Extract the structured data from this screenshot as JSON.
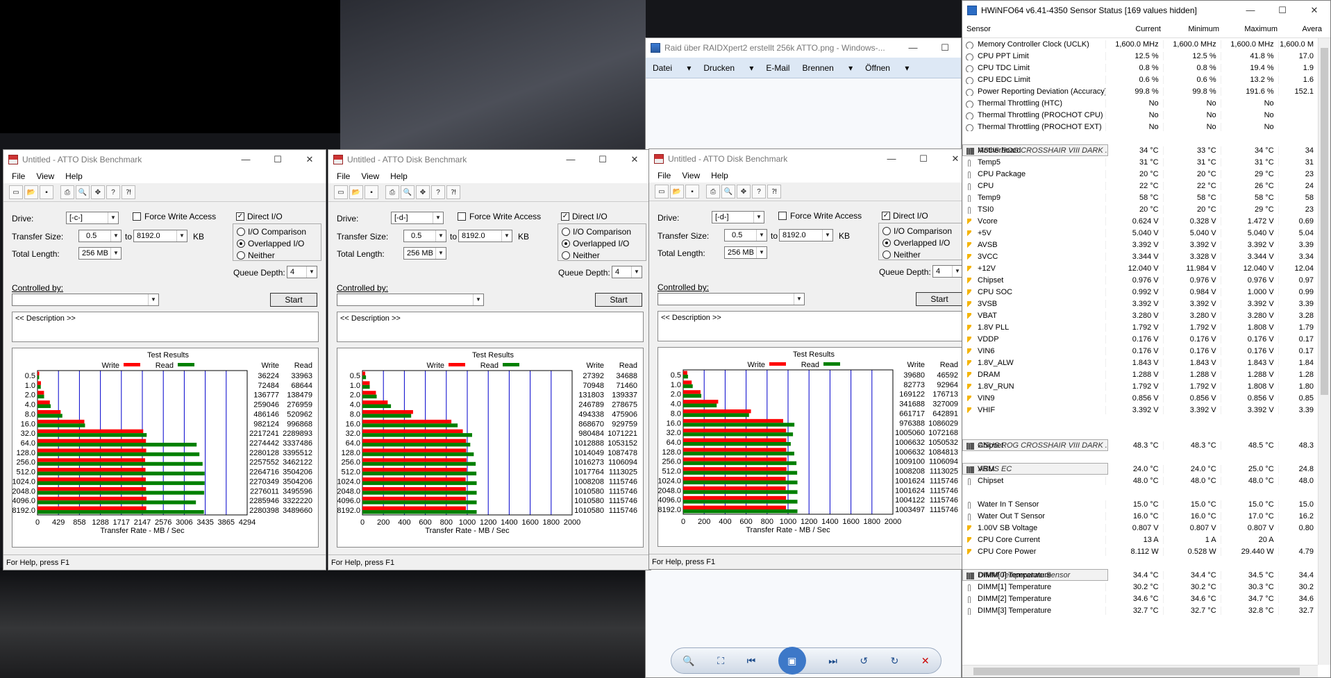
{
  "atto_windows": [
    {
      "title": "Untitled - ATTO Disk Benchmark",
      "menus": [
        "File",
        "View",
        "Help"
      ],
      "drive": "[-c-]",
      "force_write_access": "Force Write Access",
      "direct_io": "Direct I/O",
      "transfer_size_label": "Transfer Size:",
      "transfer_from": "0.5",
      "to_label": "to",
      "transfer_to": "8192.0",
      "kb_label": "KB",
      "total_length_label": "Total Length:",
      "total_length": "256 MB",
      "drive_label": "Drive:",
      "io_comparison": "I/O Comparison",
      "overlapped_io": "Overlapped I/O",
      "neither": "Neither",
      "queue_depth_label": "Queue Depth:",
      "queue_depth": "4",
      "controlled_by_label": "Controlled by:",
      "start_label": "Start",
      "description": "<< Description >>",
      "status": "For Help, press F1",
      "chart_data": {
        "type": "bar",
        "title": "Test Results",
        "xlabel": "Transfer Rate - MB / Sec",
        "legend": [
          "Write",
          "Read"
        ],
        "colors": {
          "write": "#ff0000",
          "read": "#008000"
        },
        "xlim": [
          0,
          4294
        ],
        "x_ticks": [
          "0",
          "429",
          "858",
          "1288",
          "1717",
          "2147",
          "2576",
          "3006",
          "3435",
          "3865",
          "4294"
        ],
        "categories": [
          "0.5",
          "1.0",
          "2.0",
          "4.0",
          "8.0",
          "16.0",
          "32.0",
          "64.0",
          "128.0",
          "256.0",
          "512.0",
          "1024.0",
          "2048.0",
          "4096.0",
          "8192.0"
        ],
        "write_header": "Write",
        "read_header": "Read",
        "write": [
          36224,
          72484,
          136777,
          259046,
          486146,
          982124,
          2217241,
          2274442,
          2280128,
          2257552,
          2264716,
          2270349,
          2276011,
          2285946,
          2280398
        ],
        "read": [
          33963,
          68644,
          138479,
          276959,
          520962,
          996868,
          2289893,
          3337486,
          3395512,
          3462122,
          3504206,
          3504206,
          3495596,
          3322220,
          3489660
        ]
      }
    },
    {
      "title": "Untitled - ATTO Disk Benchmark",
      "menus": [
        "File",
        "View",
        "Help"
      ],
      "drive": "[-d-]",
      "force_write_access": "Force Write Access",
      "direct_io": "Direct I/O",
      "transfer_size_label": "Transfer Size:",
      "transfer_from": "0.5",
      "to_label": "to",
      "transfer_to": "8192.0",
      "kb_label": "KB",
      "total_length_label": "Total Length:",
      "total_length": "256 MB",
      "drive_label": "Drive:",
      "io_comparison": "I/O Comparison",
      "overlapped_io": "Overlapped I/O",
      "neither": "Neither",
      "queue_depth_label": "Queue Depth:",
      "queue_depth": "4",
      "controlled_by_label": "Controlled by:",
      "start_label": "Start",
      "description": "<< Description >>",
      "status": "For Help, press F1",
      "chart_data": {
        "type": "bar",
        "title": "Test Results",
        "xlabel": "Transfer Rate - MB / Sec",
        "legend": [
          "Write",
          "Read"
        ],
        "colors": {
          "write": "#ff0000",
          "read": "#008000"
        },
        "xlim": [
          0,
          2000
        ],
        "x_ticks": [
          "0",
          "200",
          "400",
          "600",
          "800",
          "1000",
          "1200",
          "1400",
          "1600",
          "1800",
          "2000"
        ],
        "categories": [
          "0.5",
          "1.0",
          "2.0",
          "4.0",
          "8.0",
          "16.0",
          "32.0",
          "64.0",
          "128.0",
          "256.0",
          "512.0",
          "1024.0",
          "2048.0",
          "4096.0",
          "8192.0"
        ],
        "write_header": "Write",
        "read_header": "Read",
        "write": [
          27392,
          70948,
          131803,
          246789,
          494338,
          868670,
          980484,
          1012888,
          1014049,
          1016273,
          1017764,
          1008208,
          1010580,
          1010580,
          1010580
        ],
        "read": [
          34688,
          71460,
          139337,
          278675,
          475906,
          929759,
          1071221,
          1053152,
          1087478,
          1106094,
          1113025,
          1115746,
          1115746,
          1115746,
          1115746
        ]
      }
    },
    {
      "title": "Untitled - ATTO Disk Benchmark",
      "menus": [
        "File",
        "View",
        "Help"
      ],
      "drive": "[-d-]",
      "force_write_access": "Force Write Access",
      "direct_io": "Direct I/O",
      "transfer_size_label": "Transfer Size:",
      "transfer_from": "0.5",
      "to_label": "to",
      "transfer_to": "8192.0",
      "kb_label": "KB",
      "total_length_label": "Total Length:",
      "total_length": "256 MB",
      "drive_label": "Drive:",
      "io_comparison": "I/O Comparison",
      "overlapped_io": "Overlapped I/O",
      "neither": "Neither",
      "queue_depth_label": "Queue Depth:",
      "queue_depth": "4",
      "controlled_by_label": "Controlled by:",
      "start_label": "Start",
      "description": "<< Description >>",
      "status": "For Help, press F1",
      "chart_data": {
        "type": "bar",
        "title": "Test Results",
        "xlabel": "Transfer Rate - MB / Sec",
        "legend": [
          "Write",
          "Read"
        ],
        "colors": {
          "write": "#ff0000",
          "read": "#008000"
        },
        "xlim": [
          0,
          2000
        ],
        "x_ticks": [
          "0",
          "200",
          "400",
          "600",
          "800",
          "1000",
          "1200",
          "1400",
          "1600",
          "1800",
          "2000"
        ],
        "categories": [
          "0.5",
          "1.0",
          "2.0",
          "4.0",
          "8.0",
          "16.0",
          "32.0",
          "64.0",
          "128.0",
          "256.0",
          "512.0",
          "1024.0",
          "2048.0",
          "4096.0",
          "8192.0"
        ],
        "write_header": "Write",
        "read_header": "Read",
        "write": [
          39680,
          82773,
          169122,
          341688,
          661717,
          976388,
          1005060,
          1006632,
          1006632,
          1009100,
          1008208,
          1001624,
          1001624,
          1004122,
          1003497
        ],
        "read": [
          46592,
          92964,
          176713,
          327009,
          642891,
          1086029,
          1072168,
          1050532,
          1084813,
          1106094,
          1113025,
          1115746,
          1115746,
          1115746,
          1115746
        ]
      }
    }
  ],
  "viewer": {
    "title": "Raid über RAIDXpert2 erstellt 256k ATTO.png - Windows-...",
    "menus": [
      "Datei",
      "Drucken",
      "E-Mail",
      "Brennen",
      "Öffnen"
    ]
  },
  "hwinfo": {
    "title": "HWiNFO64 v6.41-4350 Sensor Status [169 values hidden]",
    "headers": [
      "Sensor",
      "Current",
      "Minimum",
      "Maximum",
      "Avera"
    ],
    "rows": [
      {
        "t": "clock",
        "n": "Memory Controller Clock (UCLK)",
        "v": [
          "1,600.0 MHz",
          "1,600.0 MHz",
          "1,600.0 MHz",
          "1,600.0 M"
        ]
      },
      {
        "t": "clock",
        "n": "CPU PPT Limit",
        "v": [
          "12.5 %",
          "12.5 %",
          "41.8 %",
          "17.0"
        ]
      },
      {
        "t": "clock",
        "n": "CPU TDC Limit",
        "v": [
          "0.8 %",
          "0.8 %",
          "19.4 %",
          "1.9"
        ]
      },
      {
        "t": "clock",
        "n": "CPU EDC Limit",
        "v": [
          "0.6 %",
          "0.6 %",
          "13.2 %",
          "1.6"
        ]
      },
      {
        "t": "clock",
        "n": "Power Reporting Deviation (Accuracy)",
        "v": [
          "99.8 %",
          "99.8 %",
          "191.6 %",
          "152.1"
        ]
      },
      {
        "t": "clock",
        "n": "Thermal Throttling (HTC)",
        "v": [
          "No",
          "No",
          "No",
          ""
        ]
      },
      {
        "t": "clock",
        "n": "Thermal Throttling (PROCHOT CPU)",
        "v": [
          "No",
          "No",
          "No",
          ""
        ]
      },
      {
        "t": "clock",
        "n": "Thermal Throttling (PROCHOT EXT)",
        "v": [
          "No",
          "No",
          "No",
          ""
        ]
      },
      {
        "t": "blank"
      },
      {
        "t": "group",
        "n": "ASUS ROG CROSSHAIR VIII DARK ..."
      },
      {
        "t": "therm",
        "n": "Motherboard",
        "v": [
          "34 °C",
          "33 °C",
          "34 °C",
          "34"
        ]
      },
      {
        "t": "therm",
        "n": "Temp5",
        "v": [
          "31 °C",
          "31 °C",
          "31 °C",
          "31"
        ]
      },
      {
        "t": "therm",
        "n": "CPU Package",
        "v": [
          "20 °C",
          "20 °C",
          "29 °C",
          "23"
        ]
      },
      {
        "t": "therm",
        "n": "CPU",
        "v": [
          "22 °C",
          "22 °C",
          "26 °C",
          "24"
        ]
      },
      {
        "t": "therm",
        "n": "Temp9",
        "v": [
          "58 °C",
          "58 °C",
          "58 °C",
          "58"
        ]
      },
      {
        "t": "therm",
        "n": "TSI0",
        "v": [
          "20 °C",
          "20 °C",
          "29 °C",
          "23"
        ]
      },
      {
        "t": "volt",
        "n": "Vcore",
        "v": [
          "0.624 V",
          "0.328 V",
          "1.472 V",
          "0.69"
        ]
      },
      {
        "t": "volt",
        "n": "+5V",
        "v": [
          "5.040 V",
          "5.040 V",
          "5.040 V",
          "5.04"
        ]
      },
      {
        "t": "volt",
        "n": "AVSB",
        "v": [
          "3.392 V",
          "3.392 V",
          "3.392 V",
          "3.39"
        ]
      },
      {
        "t": "volt",
        "n": "3VCC",
        "v": [
          "3.344 V",
          "3.328 V",
          "3.344 V",
          "3.34"
        ]
      },
      {
        "t": "volt",
        "n": "+12V",
        "v": [
          "12.040 V",
          "11.984 V",
          "12.040 V",
          "12.04"
        ]
      },
      {
        "t": "volt",
        "n": "Chipset",
        "v": [
          "0.976 V",
          "0.976 V",
          "0.976 V",
          "0.97"
        ]
      },
      {
        "t": "volt",
        "n": "CPU SOC",
        "v": [
          "0.992 V",
          "0.984 V",
          "1.000 V",
          "0.99"
        ]
      },
      {
        "t": "volt",
        "n": "3VSB",
        "v": [
          "3.392 V",
          "3.392 V",
          "3.392 V",
          "3.39"
        ]
      },
      {
        "t": "volt",
        "n": "VBAT",
        "v": [
          "3.280 V",
          "3.280 V",
          "3.280 V",
          "3.28"
        ]
      },
      {
        "t": "volt",
        "n": "1.8V PLL",
        "v": [
          "1.792 V",
          "1.792 V",
          "1.808 V",
          "1.79"
        ]
      },
      {
        "t": "volt",
        "n": "VDDP",
        "v": [
          "0.176 V",
          "0.176 V",
          "0.176 V",
          "0.17"
        ]
      },
      {
        "t": "volt",
        "n": "VIN6",
        "v": [
          "0.176 V",
          "0.176 V",
          "0.176 V",
          "0.17"
        ]
      },
      {
        "t": "volt",
        "n": "1.8V_ALW",
        "v": [
          "1.843 V",
          "1.843 V",
          "1.843 V",
          "1.84"
        ]
      },
      {
        "t": "volt",
        "n": "DRAM",
        "v": [
          "1.288 V",
          "1.288 V",
          "1.288 V",
          "1.28"
        ]
      },
      {
        "t": "volt",
        "n": "1.8V_RUN",
        "v": [
          "1.792 V",
          "1.792 V",
          "1.808 V",
          "1.80"
        ]
      },
      {
        "t": "volt",
        "n": "VIN9",
        "v": [
          "0.856 V",
          "0.856 V",
          "0.856 V",
          "0.85"
        ]
      },
      {
        "t": "volt",
        "n": "VHIF",
        "v": [
          "3.392 V",
          "3.392 V",
          "3.392 V",
          "3.39"
        ]
      },
      {
        "t": "blank"
      },
      {
        "t": "blank"
      },
      {
        "t": "group",
        "n": "ASUS ROG CROSSHAIR VIII DARK ..."
      },
      {
        "t": "therm",
        "n": "Chipset",
        "v": [
          "48.3 °C",
          "48.3 °C",
          "48.5 °C",
          "48.3"
        ]
      },
      {
        "t": "blank"
      },
      {
        "t": "group",
        "n": "ASUS EC"
      },
      {
        "t": "therm",
        "n": "VRM",
        "v": [
          "24.0 °C",
          "24.0 °C",
          "25.0 °C",
          "24.8"
        ]
      },
      {
        "t": "therm",
        "n": "Chipset",
        "v": [
          "48.0 °C",
          "48.0 °C",
          "48.0 °C",
          "48.0"
        ]
      },
      {
        "t": "blank"
      },
      {
        "t": "therm",
        "n": "Water In T Sensor",
        "v": [
          "15.0 °C",
          "15.0 °C",
          "15.0 °C",
          "15.0"
        ]
      },
      {
        "t": "therm",
        "n": "Water Out T Sensor",
        "v": [
          "16.0 °C",
          "16.0 °C",
          "17.0 °C",
          "16.2"
        ]
      },
      {
        "t": "volt",
        "n": "1.00V SB Voltage",
        "v": [
          "0.807 V",
          "0.807 V",
          "0.807 V",
          "0.80"
        ]
      },
      {
        "t": "volt",
        "n": "CPU Core Current",
        "v": [
          "13 A",
          "1 A",
          "20 A",
          ""
        ]
      },
      {
        "t": "volt",
        "n": "CPU Core Power",
        "v": [
          "8.112 W",
          "0.528 W",
          "29.440 W",
          "4.79"
        ]
      },
      {
        "t": "blank"
      },
      {
        "t": "group",
        "n": "DIMM Temperature Sensor"
      },
      {
        "t": "therm",
        "n": "DIMM[0] Temperature",
        "v": [
          "34.4 °C",
          "34.4 °C",
          "34.5 °C",
          "34.4"
        ]
      },
      {
        "t": "therm",
        "n": "DIMM[1] Temperature",
        "v": [
          "30.2 °C",
          "30.2 °C",
          "30.3 °C",
          "30.2"
        ]
      },
      {
        "t": "therm",
        "n": "DIMM[2] Temperature",
        "v": [
          "34.6 °C",
          "34.6 °C",
          "34.7 °C",
          "34.6"
        ]
      },
      {
        "t": "therm",
        "n": "DIMM[3] Temperature",
        "v": [
          "32.7 °C",
          "32.7 °C",
          "32.8 °C",
          "32.7"
        ]
      }
    ]
  }
}
